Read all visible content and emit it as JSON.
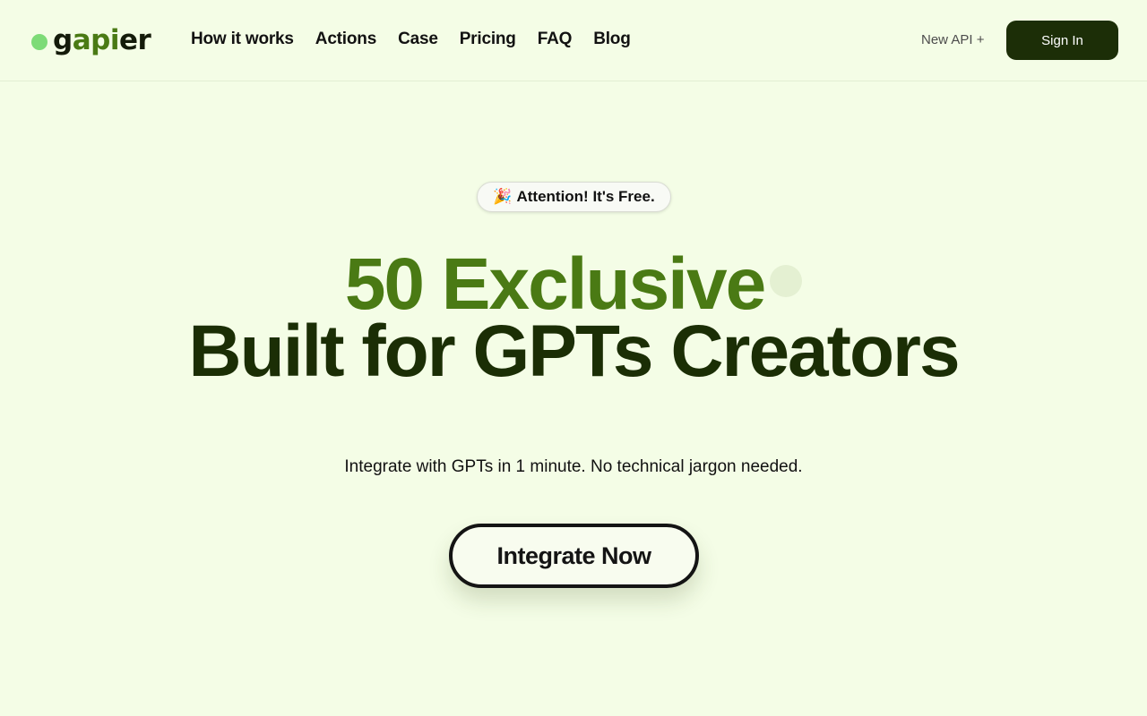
{
  "brand": {
    "logo_prefix": "g",
    "logo_highlight": "api",
    "logo_suffix": "er",
    "dot_color": "#7ddb77"
  },
  "nav": {
    "items": [
      {
        "label": "How it works"
      },
      {
        "label": "Actions"
      },
      {
        "label": "Case"
      },
      {
        "label": "Pricing"
      },
      {
        "label": "FAQ"
      },
      {
        "label": "Blog"
      }
    ],
    "new_api": "New API +",
    "sign_in": "Sign In"
  },
  "hero": {
    "badge_emoji": "🎉",
    "badge_text": "Attention! It's Free.",
    "headline_line1": "50 Exclusive",
    "headline_line2": "Built for GPTs Creators",
    "subtitle": "Integrate with GPTs in 1 minute. No technical jargon needed.",
    "cta": "Integrate Now"
  },
  "colors": {
    "background": "#f4fde6",
    "accent_green": "#4a7a14",
    "dark_green": "#1b2e05",
    "button_dark": "#1c2e07"
  }
}
